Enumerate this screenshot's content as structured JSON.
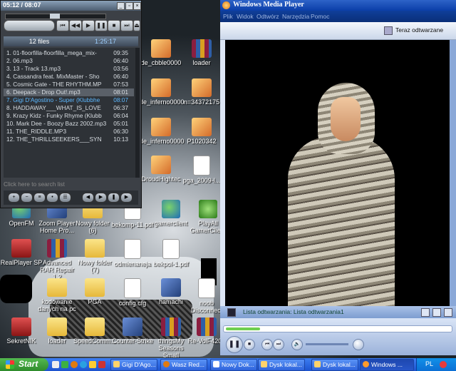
{
  "winamp": {
    "time_display": "05:12 / 08:07",
    "playlist_count": "12 files",
    "playlist_total": "1:25:17",
    "search_hint": "Click here to search list",
    "tracks": [
      {
        "title": "1. 01-floorfilla-floorfilla_mega_mix-",
        "duration": "09:35"
      },
      {
        "title": "2. 06.mp3",
        "duration": "06:40"
      },
      {
        "title": "3. 13 - Track 13.mp3",
        "duration": "03:56"
      },
      {
        "title": "4. Cassandra feat. MixMaster - Sho",
        "duration": "06:40"
      },
      {
        "title": "5. Cosmic Gate - THE RHYTHM.MP",
        "duration": "07:53"
      },
      {
        "title": "6. Deepack - Drop Out!.mp3",
        "duration": "08:01"
      },
      {
        "title": "7. Gigi D'Agostino - Super (Klubbhe",
        "duration": "08:07"
      },
      {
        "title": "8. HADDAWAY___WHAT_IS_LOVE",
        "duration": "06:37"
      },
      {
        "title": "9. Krazy Kidz - Funky Rhyme (Klubb",
        "duration": "06:04"
      },
      {
        "title": "10. Mark Dee - Boozy Bazz 2002.mp3",
        "duration": "05:01"
      },
      {
        "title": "11. THE_RIDDLE.MP3",
        "duration": "06:30"
      },
      {
        "title": "12. THE_THRILLSEEKERS___SYN",
        "duration": "10:13"
      }
    ]
  },
  "wmp": {
    "title": "Windows Media Player",
    "menu": [
      "Plik",
      "Widok",
      "Odtwórz",
      "Narzędzia",
      "Pomoc"
    ],
    "now_playing": "Teraz odtwarzane",
    "status": "Lista odtwarzania: Lista odtwarzania1"
  },
  "desktop": {
    "icons": [
      {
        "label": "OpenFM",
        "icon": "globe"
      },
      {
        "label": "Zoom Player Home Pro...",
        "icon": "app"
      },
      {
        "label": "Nowy folder (6)",
        "icon": "folder"
      },
      {
        "label": "bekomp-11.pdf",
        "icon": "doc"
      },
      {
        "label": "gamerclient",
        "icon": "globe"
      },
      {
        "label": "PlayAll GamerClient",
        "icon": "xbox"
      },
      {
        "label": "RealPlayer SP",
        "icon": "red"
      },
      {
        "label": "Advanced RAR Repair 1.2",
        "icon": "rar"
      },
      {
        "label": "Nowy folder (7)",
        "icon": "folder"
      },
      {
        "label": "odmienaneja",
        "icon": "doc"
      },
      {
        "label": "bekpol-1.pdf",
        "icon": "doc"
      },
      {
        "label": "kodowanie danych na pc",
        "icon": "folder"
      },
      {
        "label": "PGA",
        "icon": "folder"
      },
      {
        "label": "config.cfg",
        "icon": "doc"
      },
      {
        "label": "hamachi",
        "icon": "app"
      },
      {
        "label": "noob Disconnect",
        "icon": "doc"
      },
      {
        "label": "SekretNIK",
        "icon": "red"
      },
      {
        "label": "loader",
        "icon": "folder"
      },
      {
        "label": "SpeedComm...",
        "icon": "folder"
      },
      {
        "label": "Counter-Strike",
        "icon": "app"
      },
      {
        "label": "thingsMy Seasons Small",
        "icon": "rar"
      },
      {
        "label": "Re-VolF4200",
        "icon": "rar"
      },
      {
        "label": "DroudHightec",
        "icon": "img"
      },
      {
        "label": "pga_2009-l...",
        "icon": "doc"
      },
      {
        "label": "loader",
        "icon": "rar"
      },
      {
        "label": "de_cbble0000",
        "icon": "img"
      },
      {
        "label": "de_inferno0000",
        "icon": "img"
      },
      {
        "label": "P1020342",
        "icon": "img"
      },
      {
        "label": "n=34372175",
        "icon": "img"
      }
    ]
  },
  "taskbar": {
    "start": "Start",
    "tasks": [
      {
        "label": "Gigi D'Ago...",
        "active": false
      },
      {
        "label": "Wasz Red...",
        "active": false
      },
      {
        "label": "Nowy Dok...",
        "active": false
      },
      {
        "label": "Dysk lokal...",
        "active": false
      },
      {
        "label": "Dysk lokal...",
        "active": false
      },
      {
        "label": "Windows ...",
        "active": true
      }
    ],
    "tray_lang": "PL"
  }
}
